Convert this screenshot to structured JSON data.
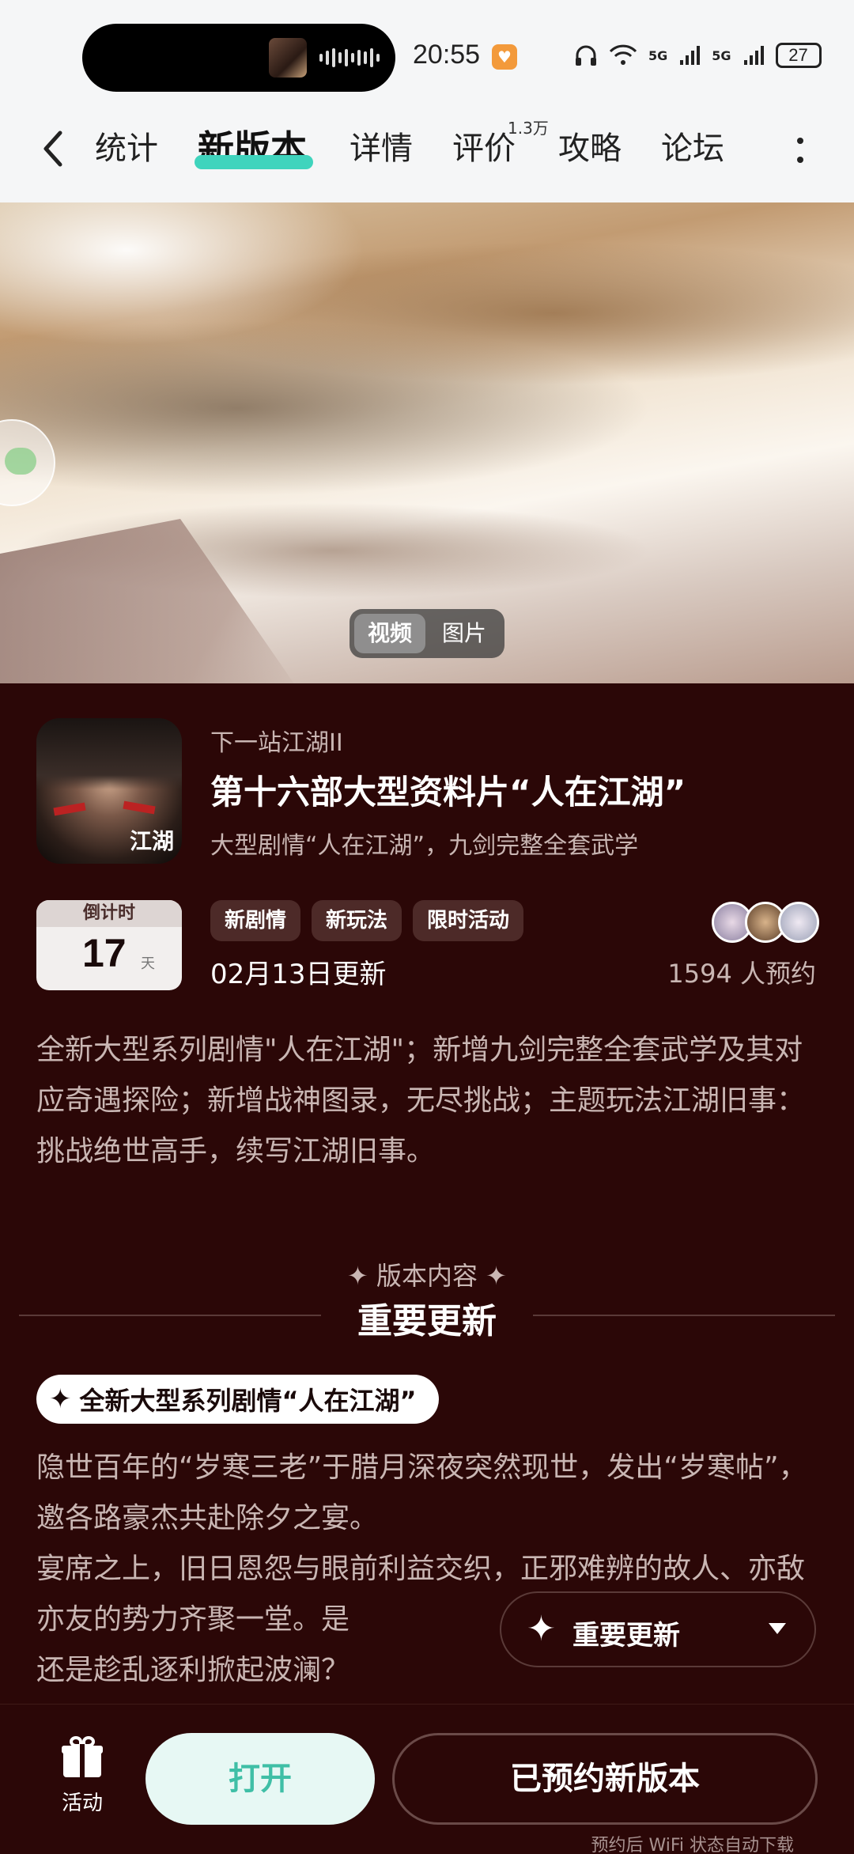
{
  "status_bar": {
    "time": "20:55",
    "battery": "27",
    "network_1": "5G",
    "network_2": "5G"
  },
  "nav": {
    "tabs": [
      {
        "label": "统计"
      },
      {
        "label": "新版本"
      },
      {
        "label": "详情"
      },
      {
        "label": "评价"
      },
      {
        "label": "攻略"
      },
      {
        "label": "论坛"
      }
    ],
    "active_tab": "新版本",
    "review_count": "1.3万"
  },
  "media": {
    "switch_video": "视频",
    "switch_image": "图片"
  },
  "app": {
    "name": "下一站江湖II",
    "icon_logo_text": "江湖",
    "headline": "第十六部大型资料片“人在江湖”",
    "tagline": "大型剧情“人在江湖”，九剑完整全套武学"
  },
  "countdown": {
    "header": "倒计时",
    "number": "17",
    "unit": "天"
  },
  "tags": [
    "新剧情",
    "新玩法",
    "限时活动"
  ],
  "update_date": "02月13日更新",
  "reservations": "1594 人预约",
  "intro": "全新大型系列剧情\"人在江湖\"；新增九剑完整全套武学及其对应奇遇探险；新增战神图录，无尽挑战；主题玩法江湖旧事：挑战绝世高手，续写江湖旧事。",
  "section": {
    "kicker": "✦ 版本内容 ✦",
    "title": "重要更新"
  },
  "feature": {
    "star": "✦",
    "title": "全新大型系列剧情“人在江湖”",
    "paragraph_1": "隐世百年的“岁寒三老”于腊月深夜突然现世，发出“岁寒帖”，邀各路豪杰共赴除夕之宴。",
    "paragraph_2": "宴席之上，旧日恩怨与眼前利益交织，正邪难辨的故人、亦敌亦友的势力齐聚一堂。是",
    "paragraph_3": "还是趁乱逐利掀起波澜？"
  },
  "float_button": {
    "star": "✦",
    "label": "重要更新"
  },
  "bottom_bar": {
    "activity_label": "活动",
    "open_label": "打开",
    "reserved_label": "已预约新版本",
    "wifi_note": "预约后 WiFi 状态自动下载"
  },
  "colors": {
    "accent": "#3fd4bd",
    "background": "#2b0707",
    "open_button_bg": "#e7f8f4"
  }
}
